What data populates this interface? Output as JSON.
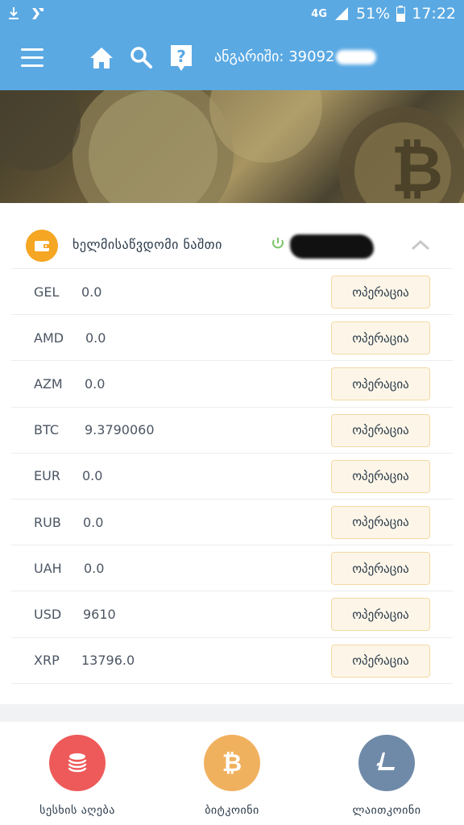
{
  "status_bar": {
    "network": "4G",
    "battery": "51%",
    "time": "17:22"
  },
  "header": {
    "account_label": "ანგარიში: 39092"
  },
  "balance": {
    "title": "ხელმისაწვდომი ნაშთი",
    "button_label": "ოპერაცია",
    "rows": [
      {
        "currency": "GEL",
        "amount": "0.0"
      },
      {
        "currency": "AMD",
        "amount": "0.0"
      },
      {
        "currency": "AZM",
        "amount": "0.0"
      },
      {
        "currency": "BTC",
        "amount": "9.3790060"
      },
      {
        "currency": "EUR",
        "amount": "0.0"
      },
      {
        "currency": "RUB",
        "amount": "0.0"
      },
      {
        "currency": "UAH",
        "amount": "0.0"
      },
      {
        "currency": "USD",
        "amount": "9610"
      },
      {
        "currency": "XRP",
        "amount": "13796.0"
      }
    ]
  },
  "bottom_nav": [
    {
      "label": "სესხის აღება",
      "icon": "coins-stack-icon",
      "color": "#ee5a5a"
    },
    {
      "label": "ბიტკოინი",
      "icon": "bitcoin-icon",
      "color": "#f0b15f"
    },
    {
      "label": "ლაითკოინი",
      "icon": "litecoin-icon",
      "color": "#6f8aa8"
    }
  ],
  "colors": {
    "primary": "#5aa9e3",
    "wallet": "#f5a623",
    "button_bg": "#fdf6e8",
    "button_border": "#f3d9a4"
  }
}
